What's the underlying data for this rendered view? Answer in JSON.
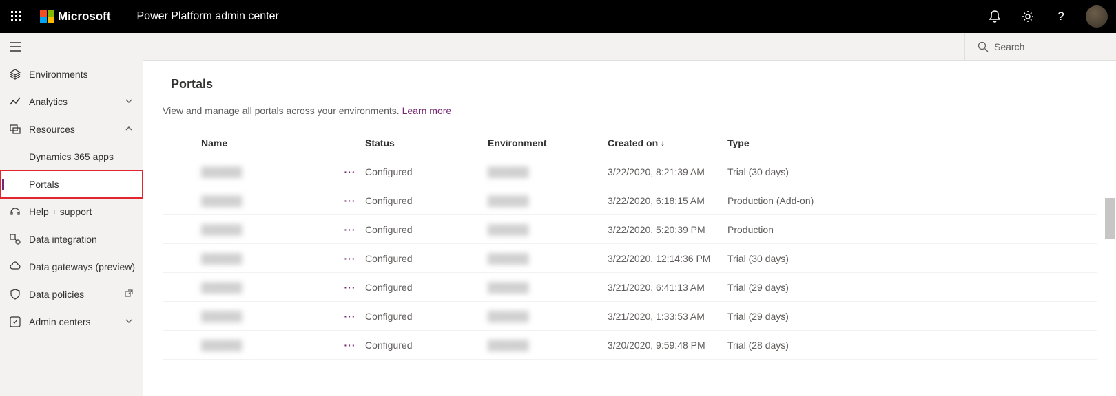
{
  "header": {
    "brand": "Microsoft",
    "app_title": "Power Platform admin center"
  },
  "search": {
    "placeholder": "Search"
  },
  "sidebar": {
    "items": [
      {
        "label": "Environments"
      },
      {
        "label": "Analytics"
      },
      {
        "label": "Resources"
      },
      {
        "label": "Dynamics 365 apps"
      },
      {
        "label": "Portals"
      },
      {
        "label": "Help + support"
      },
      {
        "label": "Data integration"
      },
      {
        "label": "Data gateways (preview)"
      },
      {
        "label": "Data policies"
      },
      {
        "label": "Admin centers"
      }
    ]
  },
  "page": {
    "title": "Portals",
    "description": "View and manage all portals across your environments. ",
    "learn_more": "Learn more"
  },
  "table": {
    "columns": {
      "name": "Name",
      "status": "Status",
      "environment": "Environment",
      "created": "Created on",
      "type": "Type"
    },
    "rows": [
      {
        "name": "██████",
        "status": "Configured",
        "environment": "██████",
        "created": "3/22/2020, 8:21:39 AM",
        "type": "Trial (30 days)"
      },
      {
        "name": "██████",
        "status": "Configured",
        "environment": "██████",
        "created": "3/22/2020, 6:18:15 AM",
        "type": "Production (Add-on)"
      },
      {
        "name": "██████",
        "status": "Configured",
        "environment": "██████",
        "created": "3/22/2020, 5:20:39 PM",
        "type": "Production"
      },
      {
        "name": "██████",
        "status": "Configured",
        "environment": "██████",
        "created": "3/22/2020, 12:14:36 PM",
        "type": "Trial (30 days)"
      },
      {
        "name": "██████",
        "status": "Configured",
        "environment": "██████",
        "created": "3/21/2020, 6:41:13 AM",
        "type": "Trial (29 days)"
      },
      {
        "name": "██████",
        "status": "Configured",
        "environment": "██████",
        "created": "3/21/2020, 1:33:53 AM",
        "type": "Trial (29 days)"
      },
      {
        "name": "██████",
        "status": "Configured",
        "environment": "██████",
        "created": "3/20/2020, 9:59:48 PM",
        "type": "Trial (28 days)"
      }
    ]
  }
}
